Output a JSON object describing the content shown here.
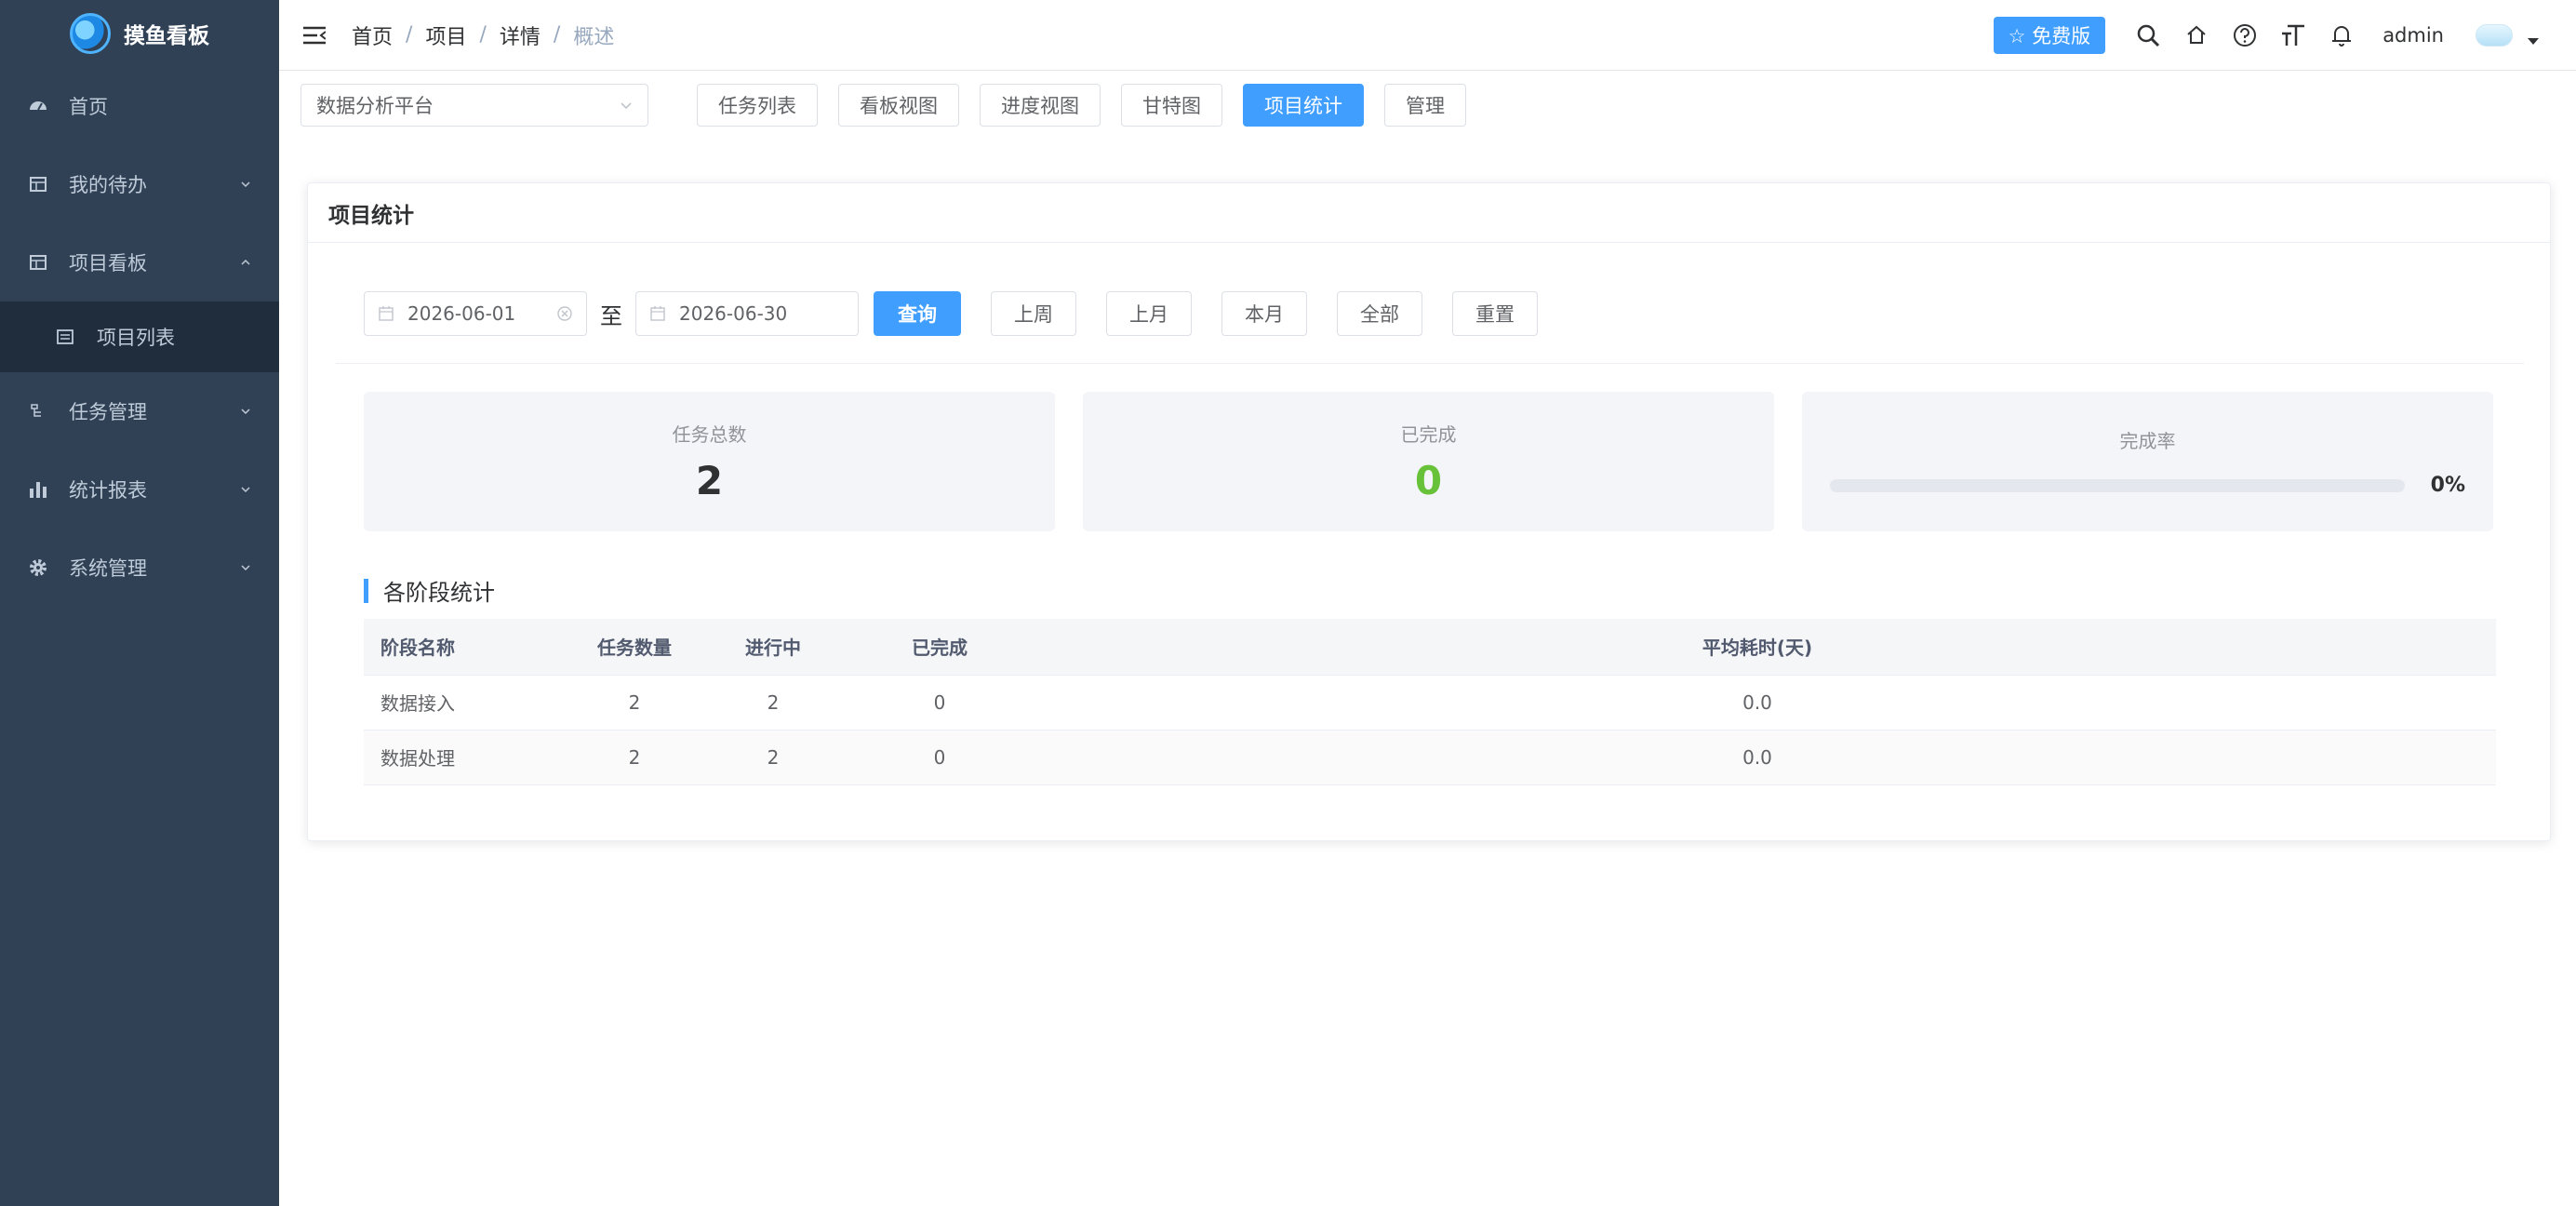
{
  "sidebar": {
    "logo_text": "摸鱼看板",
    "items": [
      {
        "label": "首页",
        "icon": "dashboard-icon"
      },
      {
        "label": "我的待办",
        "icon": "table-icon"
      },
      {
        "label": "项目看板",
        "icon": "board-icon"
      },
      {
        "label": "项目列表",
        "icon": "list-icon"
      },
      {
        "label": "任务管理",
        "icon": "tree-icon"
      },
      {
        "label": "统计报表",
        "icon": "chart-icon"
      },
      {
        "label": "系统管理",
        "icon": "gear-icon"
      }
    ]
  },
  "header": {
    "breadcrumb": [
      "首页",
      "项目",
      "详情",
      "概述"
    ],
    "separator": "/",
    "free_label": "☆ 免费版",
    "username": "admin"
  },
  "toolbar": {
    "project_select": "数据分析平台",
    "views": [
      "任务列表",
      "看板视图",
      "进度视图",
      "甘特图",
      "项目统计",
      "管理"
    ],
    "active_view": "项目统计"
  },
  "card": {
    "title": "项目统计",
    "start_date": "2026-06-01",
    "to_label": "至",
    "end_date": "2026-06-30",
    "query_label": "查询",
    "filter_buttons": [
      "上周",
      "上月",
      "本月",
      "全部",
      "重置"
    ],
    "stats": {
      "total_label": "任务总数",
      "total_value": "2",
      "done_label": "已完成",
      "done_value": "0",
      "rate_label": "完成率",
      "rate_value": "0%",
      "rate_fraction": 0
    },
    "section_title": "各阶段统计",
    "table": {
      "headers": [
        "阶段名称",
        "任务数量",
        "进行中",
        "已完成",
        "平均耗时(天)"
      ],
      "rows": [
        [
          "数据接入",
          "2",
          "2",
          "0",
          "0.0"
        ],
        [
          "数据处理",
          "2",
          "2",
          "0",
          "0.0"
        ]
      ]
    }
  },
  "colors": {
    "sidebar_bg": "#304156",
    "primary": "#409eff",
    "success": "#67c23a"
  }
}
